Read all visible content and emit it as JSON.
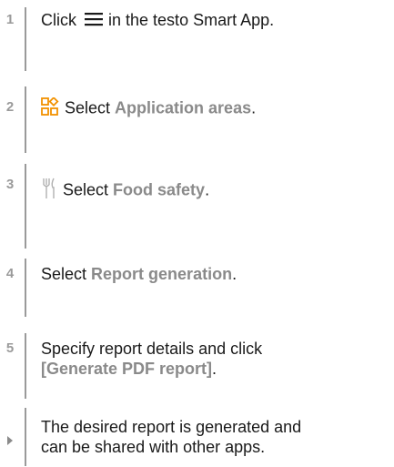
{
  "steps": [
    {
      "number": "1",
      "before": "Click",
      "icon": "menu-icon",
      "after": "in the testo Smart App."
    },
    {
      "number": "2",
      "icon": "application-areas-icon",
      "before": "Select",
      "bold": "Application areas",
      "after": "."
    },
    {
      "number": "3",
      "icon": "food-safety-icon",
      "before": "Select",
      "bold": "Food safety",
      "after": "."
    },
    {
      "number": "4",
      "before": "Select",
      "bold": "Report generation",
      "after": "."
    },
    {
      "number": "5",
      "line1": "Specify report details and click",
      "bold": "[Generate PDF report]",
      "after": "."
    }
  ],
  "result": {
    "icon": "result-arrow-icon",
    "line1": "The desired report is generated and",
    "line2": "can be shared with other apps."
  },
  "colors": {
    "accent_orange": "#f29100",
    "label_gray": "#8a8a8a",
    "bar_gray": "#9a9a9a"
  }
}
